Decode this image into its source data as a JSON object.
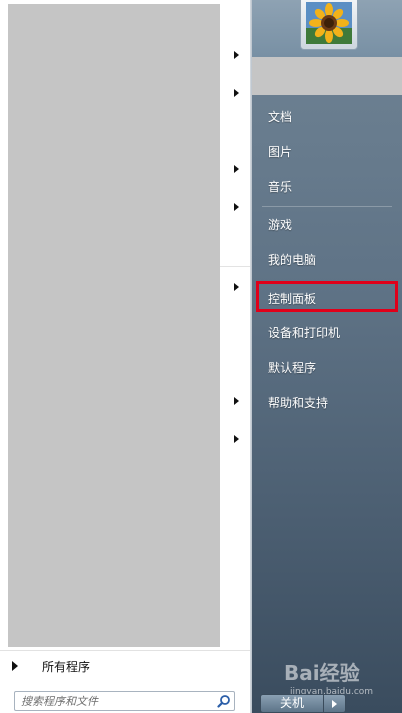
{
  "left_pane": {
    "all_programs_label": "所有程序",
    "search": {
      "placeholder": "搜索程序和文件",
      "value": ""
    }
  },
  "right_pane": {
    "items": [
      {
        "label": "文档"
      },
      {
        "label": "图片"
      },
      {
        "label": "音乐"
      },
      {
        "label": "游戏"
      },
      {
        "label": "我的电脑"
      },
      {
        "label": "控制面板",
        "highlighted": true
      },
      {
        "label": "设备和打印机"
      },
      {
        "label": "默认程序"
      },
      {
        "label": "帮助和支持"
      }
    ],
    "shutdown_label": "关机",
    "highlight_color": "#e0001a"
  },
  "watermark": {
    "brand": "Bai",
    "suffix": "经验",
    "url": "jingyan.baidu.com"
  },
  "icons": {
    "avatar": "sunflower-avatar",
    "search": "magnifier-icon",
    "submenu": "triangle-right-icon"
  }
}
